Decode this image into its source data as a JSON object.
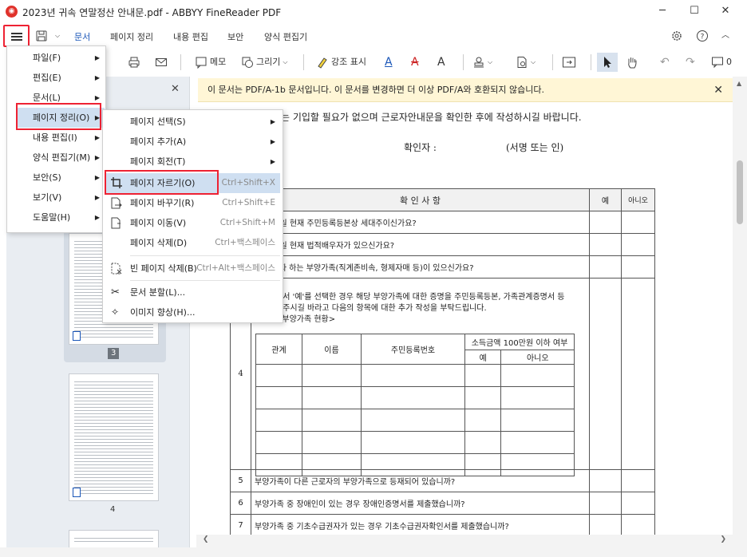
{
  "window": {
    "title": "2023년 귀속 연말정산 안내문.pdf - ABBYY FineReader PDF",
    "controls": [
      "─",
      "☐",
      "✕"
    ]
  },
  "menubar": {
    "tabs": [
      "문서",
      "페이지 정리",
      "내용 편집",
      "보안",
      "양식 편집기"
    ],
    "active_tab": "문서"
  },
  "toolbar": {
    "memo": "메모",
    "draw": "그리기",
    "highlight": "강조 표시",
    "comment_count": "0"
  },
  "infobar": {
    "message": "이 문서는 PDF/A-1b 문서입니다. 이 문서를 변경하면 더 이상 PDF/A와 호환되지 않습니다."
  },
  "sidepanel": {
    "page_numbers": [
      "3",
      "4"
    ]
  },
  "document": {
    "intro_line": "는 기입할 필요가 없으며 근로자안내문을 확인한 후에 작성하시길 바랍니다.",
    "confirmer_label": "확인자 :",
    "signature_label": "(서명 또는 인)",
    "table_header": "확 인 사 항",
    "col_yes": "예",
    "col_no": "아니오",
    "rows": [
      "2월 31일 현재 주민등록등본상 세대주이신가요?",
      "2월 31일 현재 법적배우자가 있으신가요?",
      "를 받고자 하는 부양가족(직계존비속, 형제자매 등)이 있으신가요?"
    ],
    "row4_line1": "에서 '예'를 선택한 경우 해당 부양가족에 대한 증명을 주민등록등본, 가족관계증명서 등",
    "row4_line2": "해주시길 바라고 다음의 항목에 대한 추가 작성을 부탁드립니다.",
    "row4_line3": "<부양가족 현황>",
    "row4_number": "4",
    "inner_headers": [
      "관계",
      "이름",
      "주민등록번호",
      "소득금액 100만원 이하 여부"
    ],
    "inner_sub": [
      "예",
      "아니오"
    ],
    "row5_num": "5",
    "row5_text": "부양가족이 다른 근로자의 부양가족으로 등재되어 있습니까?",
    "row6_num": "6",
    "row6_text": "부양가족 중 장애인이 있는 경우 장애인증명서를 제출했습니까?",
    "row7_num": "7",
    "row7_text": "부양가족 중 기초수급권자가 있는 경우 기초수급권자확인서를 제출했습니까?"
  },
  "main_menu": {
    "items": [
      "파일(F)",
      "편집(E)",
      "문서(L)",
      "페이지 정리(O)",
      "내용 편집(I)",
      "양식 편집기(M)",
      "보안(S)",
      "보기(V)",
      "도움말(H)"
    ]
  },
  "submenu": {
    "items": [
      {
        "label": "페이지 선택(S)",
        "shortcut": ""
      },
      {
        "label": "페이지 추가(A)",
        "shortcut": ""
      },
      {
        "label": "페이지 회전(T)",
        "shortcut": ""
      },
      {
        "label": "페이지 자르기(O)",
        "shortcut": "Ctrl+Shift+X"
      },
      {
        "label": "페이지 바꾸기(R)",
        "shortcut": "Ctrl+Shift+E"
      },
      {
        "label": "페이지 이동(V)",
        "shortcut": "Ctrl+Shift+M"
      },
      {
        "label": "페이지 삭제(D)",
        "shortcut": "Ctrl+백스페이스"
      },
      {
        "label": "빈 페이지 삭제(B)",
        "shortcut": "Ctrl+Alt+백스페이스"
      },
      {
        "label": "문서 분할(L)...",
        "shortcut": ""
      },
      {
        "label": "이미지 향상(H)...",
        "shortcut": ""
      }
    ]
  },
  "colors": {
    "accent": "#1a56b8",
    "highlight_box": "#e23333",
    "info_bg": "#fff6d6"
  }
}
